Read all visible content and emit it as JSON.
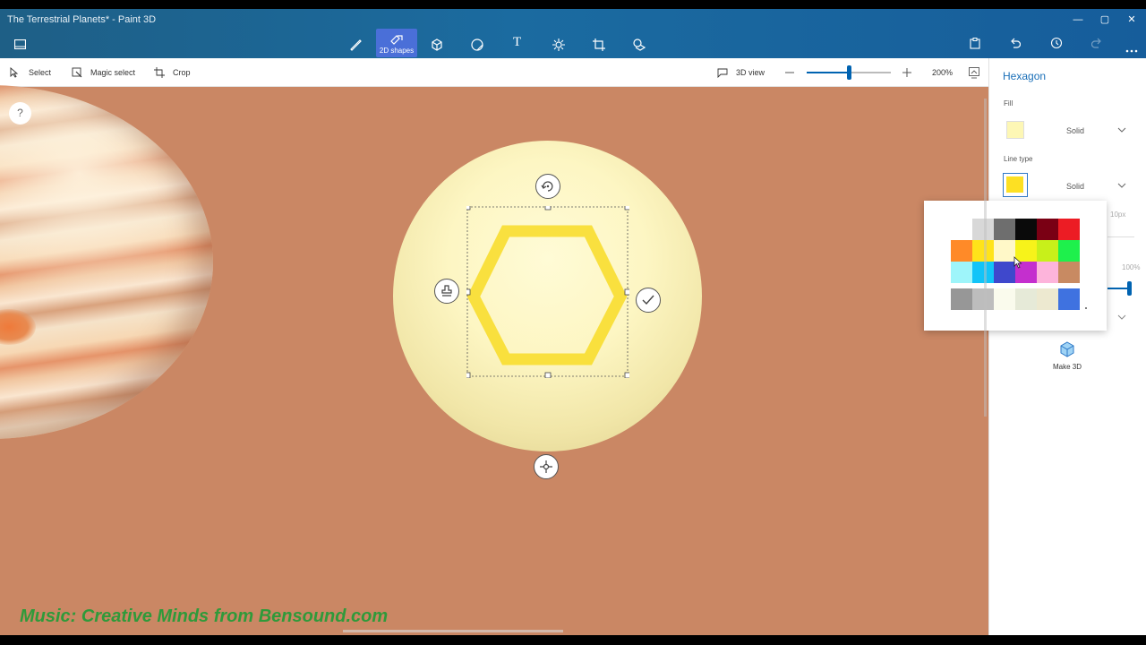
{
  "window": {
    "title": "The Terrestrial Planets* - Paint 3D",
    "controls": [
      "—",
      "▢",
      "✕"
    ]
  },
  "main_tools": [
    {
      "name": "brushes",
      "label": ""
    },
    {
      "name": "2d-shapes",
      "label": "2D shapes"
    },
    {
      "name": "3d-shapes",
      "label": ""
    },
    {
      "name": "stickers",
      "label": ""
    },
    {
      "name": "text",
      "label": "T"
    },
    {
      "name": "effects",
      "label": ""
    },
    {
      "name": "canvas",
      "label": ""
    },
    {
      "name": "3d-library",
      "label": ""
    }
  ],
  "toolbar": {
    "select": "Select",
    "magic_select": "Magic select",
    "crop": "Crop",
    "view_3d": "3D view",
    "zoom_level": "200%",
    "zoom_fraction": 0.5
  },
  "panel": {
    "title": "Hexagon",
    "fill_label": "Fill",
    "fill_type": "Solid",
    "fill_color": "#fdf7b5",
    "line_label": "Line type",
    "line_type": "Solid",
    "line_color": "#fde023",
    "thickness": "10px",
    "opacity": "100%",
    "make3d": "Make 3D"
  },
  "help": "?",
  "palette": [
    [
      "#ffffff",
      "#d8d8d8",
      "#6e6e6e",
      "#0a0a0a",
      "#7a0014",
      "#ec1c24"
    ],
    [
      "#ff8a28",
      "#ffe31a",
      "#fff8c8",
      "#f7f31a",
      "#c8f01a",
      "#1ef04c"
    ],
    [
      "#9ef5fa",
      "#12c4f8",
      "#3f48cc",
      "#c42fce",
      "#fdb4db",
      "#c88a62"
    ],
    [
      "#979797",
      "#bdbdbd",
      "#fafbed",
      "#e6ead8",
      "#ede9d0",
      "#3f72e0"
    ]
  ],
  "watermark": "Music: Creative Minds from Bensound.com"
}
